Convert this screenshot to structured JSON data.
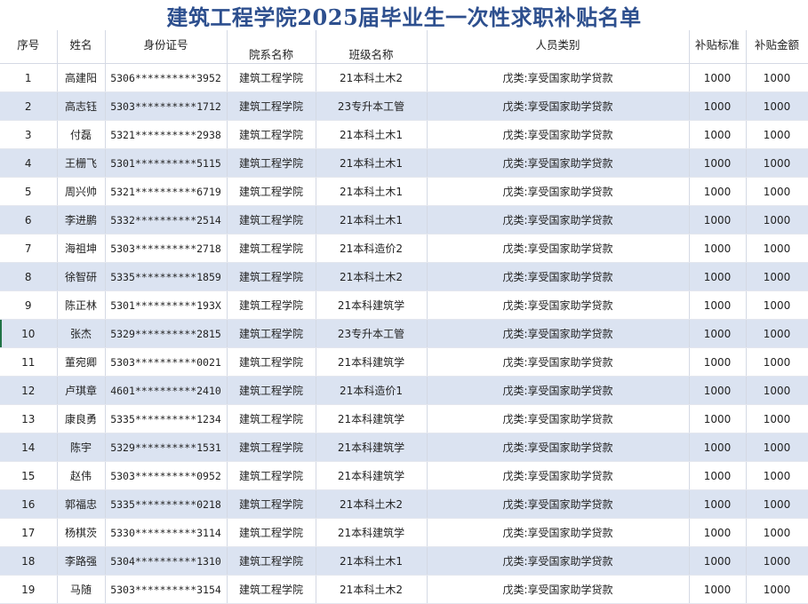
{
  "title": "建筑工程学院2025届毕业生一次性求职补贴名单",
  "columns": {
    "seq": "序号",
    "name": "姓名",
    "id": "身份证号",
    "college": "院系名称",
    "class": "班级名称",
    "category": "人员类别",
    "standard": "补贴标准",
    "amount": "补贴金额"
  },
  "rows": [
    {
      "seq": "1",
      "name": "高建阳",
      "id": "5306**********3952",
      "college": "建筑工程学院",
      "class": "21本科土木2",
      "category": "戊类:享受国家助学贷款",
      "standard": "1000",
      "amount": "1000"
    },
    {
      "seq": "2",
      "name": "高志钰",
      "id": "5303**********1712",
      "college": "建筑工程学院",
      "class": "23专升本工管",
      "category": "戊类:享受国家助学贷款",
      "standard": "1000",
      "amount": "1000"
    },
    {
      "seq": "3",
      "name": "付磊",
      "id": "5321**********2938",
      "college": "建筑工程学院",
      "class": "21本科土木1",
      "category": "戊类:享受国家助学贷款",
      "standard": "1000",
      "amount": "1000"
    },
    {
      "seq": "4",
      "name": "王栅飞",
      "id": "5301**********5115",
      "college": "建筑工程学院",
      "class": "21本科土木1",
      "category": "戊类:享受国家助学贷款",
      "standard": "1000",
      "amount": "1000"
    },
    {
      "seq": "5",
      "name": "周兴帅",
      "id": "5321**********6719",
      "college": "建筑工程学院",
      "class": "21本科土木1",
      "category": "戊类:享受国家助学贷款",
      "standard": "1000",
      "amount": "1000"
    },
    {
      "seq": "6",
      "name": "李进鹏",
      "id": "5332**********2514",
      "college": "建筑工程学院",
      "class": "21本科土木1",
      "category": "戊类:享受国家助学贷款",
      "standard": "1000",
      "amount": "1000"
    },
    {
      "seq": "7",
      "name": "海祖坤",
      "id": "5303**********2718",
      "college": "建筑工程学院",
      "class": "21本科造价2",
      "category": "戊类:享受国家助学贷款",
      "standard": "1000",
      "amount": "1000"
    },
    {
      "seq": "8",
      "name": "徐智研",
      "id": "5335**********1859",
      "college": "建筑工程学院",
      "class": "21本科土木2",
      "category": "戊类:享受国家助学贷款",
      "standard": "1000",
      "amount": "1000"
    },
    {
      "seq": "9",
      "name": "陈正林",
      "id": "5301**********193X",
      "college": "建筑工程学院",
      "class": "21本科建筑学",
      "category": "戊类:享受国家助学贷款",
      "standard": "1000",
      "amount": "1000"
    },
    {
      "seq": "10",
      "name": "张杰",
      "id": "5329**********2815",
      "college": "建筑工程学院",
      "class": "23专升本工管",
      "category": "戊类:享受国家助学贷款",
      "standard": "1000",
      "amount": "1000"
    },
    {
      "seq": "11",
      "name": "董宛卿",
      "id": "5303**********0021",
      "college": "建筑工程学院",
      "class": "21本科建筑学",
      "category": "戊类:享受国家助学贷款",
      "standard": "1000",
      "amount": "1000"
    },
    {
      "seq": "12",
      "name": "卢琪章",
      "id": "4601**********2410",
      "college": "建筑工程学院",
      "class": "21本科造价1",
      "category": "戊类:享受国家助学贷款",
      "standard": "1000",
      "amount": "1000"
    },
    {
      "seq": "13",
      "name": "康良勇",
      "id": "5335**********1234",
      "college": "建筑工程学院",
      "class": "21本科建筑学",
      "category": "戊类:享受国家助学贷款",
      "standard": "1000",
      "amount": "1000"
    },
    {
      "seq": "14",
      "name": "陈宇",
      "id": "5329**********1531",
      "college": "建筑工程学院",
      "class": "21本科建筑学",
      "category": "戊类:享受国家助学贷款",
      "standard": "1000",
      "amount": "1000"
    },
    {
      "seq": "15",
      "name": "赵伟",
      "id": "5303**********0952",
      "college": "建筑工程学院",
      "class": "21本科建筑学",
      "category": "戊类:享受国家助学贷款",
      "standard": "1000",
      "amount": "1000"
    },
    {
      "seq": "16",
      "name": "郭福忠",
      "id": "5335**********0218",
      "college": "建筑工程学院",
      "class": "21本科土木2",
      "category": "戊类:享受国家助学贷款",
      "standard": "1000",
      "amount": "1000"
    },
    {
      "seq": "17",
      "name": "杨棋茨",
      "id": "5330**********3114",
      "college": "建筑工程学院",
      "class": "21本科建筑学",
      "category": "戊类:享受国家助学贷款",
      "standard": "1000",
      "amount": "1000"
    },
    {
      "seq": "18",
      "name": "李路强",
      "id": "5304**********1310",
      "college": "建筑工程学院",
      "class": "21本科土木1",
      "category": "戊类:享受国家助学贷款",
      "standard": "1000",
      "amount": "1000"
    },
    {
      "seq": "19",
      "name": "马随",
      "id": "5303**********3154",
      "college": "建筑工程学院",
      "class": "21本科土木2",
      "category": "戊类:享受国家助学贷款",
      "standard": "1000",
      "amount": "1000"
    }
  ],
  "colors": {
    "title": "#2d4f8e",
    "band": "#dbe3f1",
    "selection": "#217346"
  }
}
